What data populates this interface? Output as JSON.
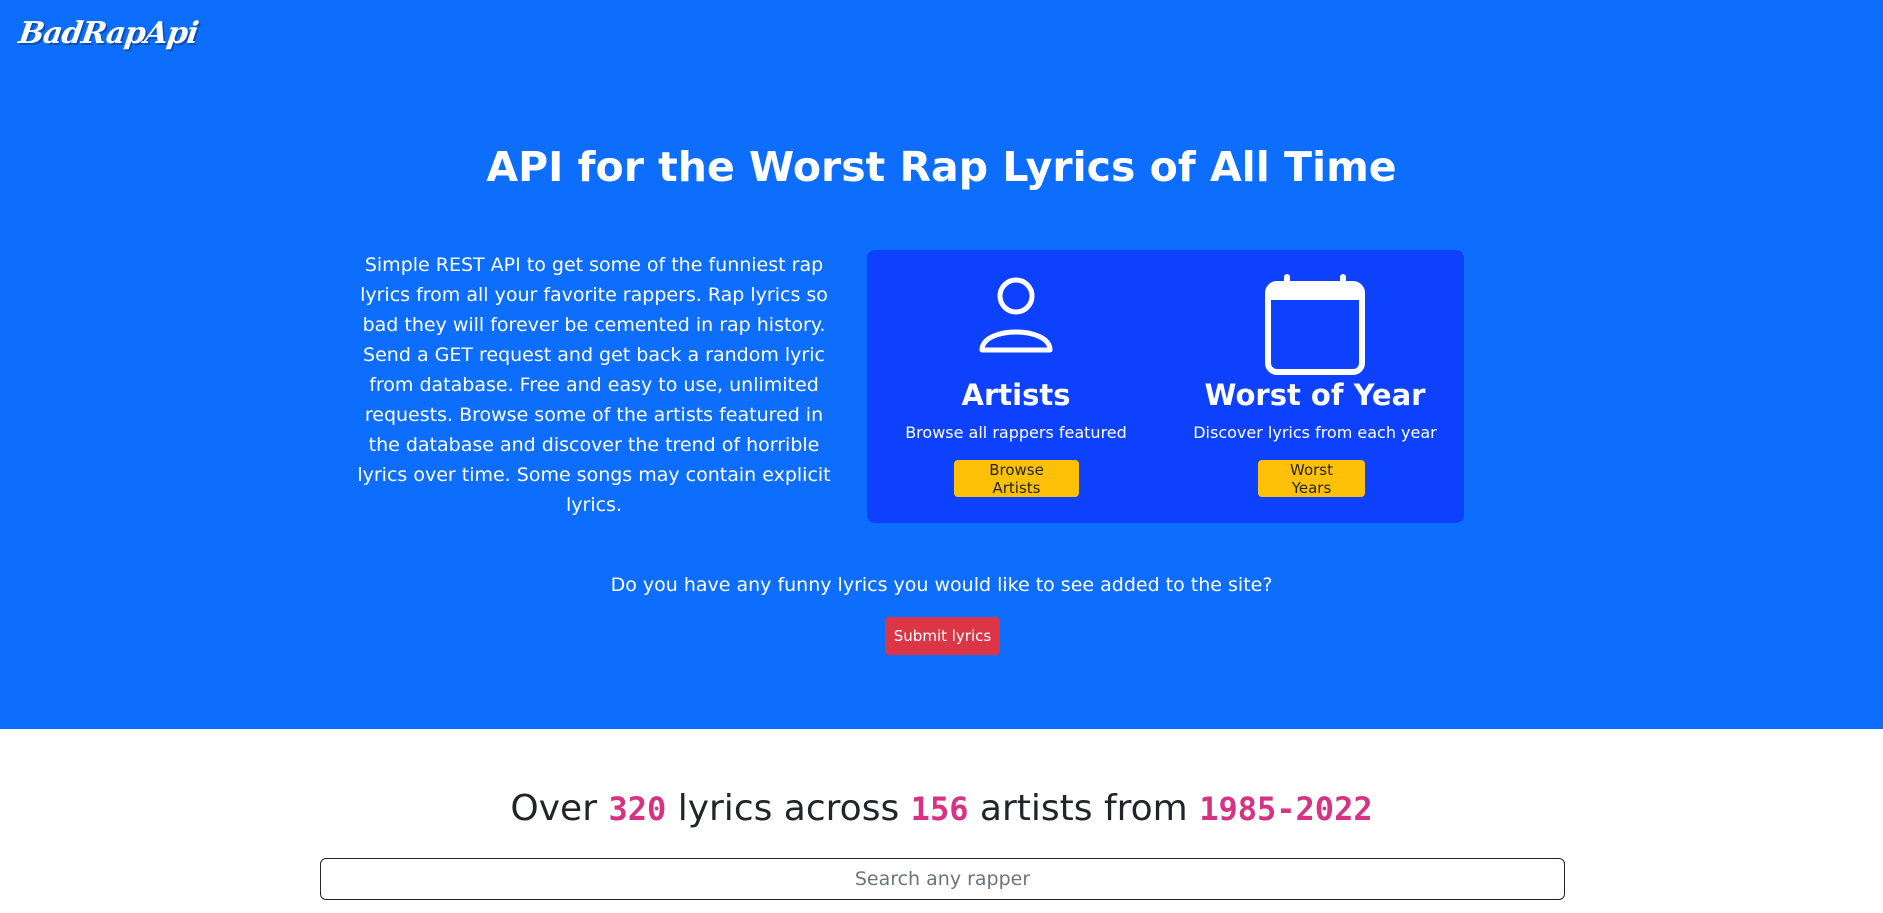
{
  "header": {
    "logo_text": "BadRapApi"
  },
  "hero": {
    "title": "API for the Worst Rap Lyrics of All Time",
    "intro": "Simple REST API to get some of the funniest rap lyrics from all your favorite rappers. Rap lyrics so bad they will forever be cemented in rap history. Send a GET request and get back a random lyric from database. Free and easy to use, unlimited requests. Browse some of the artists featured in the database and discover the trend of horrible lyrics over time. Some songs may contain explicit lyrics.",
    "cards": {
      "artists": {
        "icon": "person-icon",
        "title": "Artists",
        "subtitle": "Browse all rappers featured",
        "button": "Browse Artists"
      },
      "years": {
        "icon": "calendar-icon",
        "title": "Worst of Year",
        "subtitle": "Discover lyrics from each year",
        "button": "Worst Years"
      }
    },
    "question": "Do you have any funny lyrics you would like to see added to the site?",
    "submit_button": "Submit lyrics"
  },
  "stats": {
    "prefix": "Over",
    "lyrics_count": "320",
    "middle1": "lyrics across",
    "artists_count": "156",
    "middle2": "artists from",
    "year_range": "1985-2022"
  },
  "search": {
    "placeholder": "Search any rapper",
    "value": ""
  },
  "colors": {
    "hero_bg": "#0d6efd",
    "card_bg": "#0d41fd",
    "warning": "#ffc107",
    "danger": "#dc3545",
    "code": "#d63384"
  }
}
